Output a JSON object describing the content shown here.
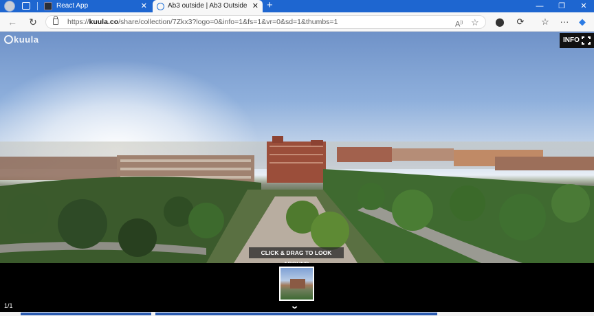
{
  "browser": {
    "tabs": [
      {
        "title": "React App",
        "active": false
      },
      {
        "title": "Ab3 outside | Ab3 Outside",
        "active": true
      }
    ],
    "new_tab_symbol": "+",
    "close_symbol": "✕",
    "window_controls": {
      "minimize": "—",
      "restore": "❐",
      "close": "✕"
    },
    "url_prefix": "https://",
    "url_domain": "kuula.co",
    "url_path": "/share/collection/7Zkx3?logo=0&info=1&fs=1&vr=0&sd=1&thumbs=1",
    "more_symbol": "···",
    "accent_color": "#1e66d0"
  },
  "viewer": {
    "logo_text": "kuula",
    "info_label": "INFO",
    "drag_hint": "CLICK & DRAG TO LOOK AROUND",
    "counter": "1/1",
    "chevron": "⌄"
  },
  "icons": {
    "back": "back-arrow-icon",
    "refresh": "refresh-icon",
    "lock": "lock-icon",
    "read_aloud": "read-aloud-icon",
    "favorite": "star-icon",
    "collections": "collections-icon",
    "extensions": "puzzle-icon",
    "favorites_bar": "favorites-icon",
    "copilot": "copilot-icon",
    "fullscreen": "fullscreen-icon"
  }
}
